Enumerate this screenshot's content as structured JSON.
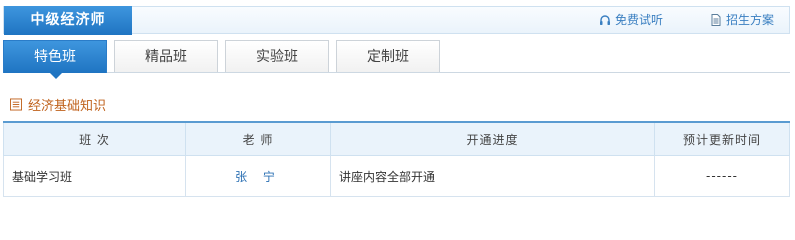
{
  "header": {
    "title": "中级经济师",
    "links": {
      "free_trial": "免费试听",
      "enrollment_plan": "招生方案"
    }
  },
  "tabs": [
    {
      "label": "特色班",
      "active": true
    },
    {
      "label": "精品班",
      "active": false
    },
    {
      "label": "实验班",
      "active": false
    },
    {
      "label": "定制班",
      "active": false
    }
  ],
  "section": {
    "title": "经济基础知识"
  },
  "table": {
    "headers": [
      "班 次",
      "老 师",
      "开通进度",
      "预计更新时间"
    ],
    "rows": [
      {
        "class_name": "基础学习班",
        "teacher": "张 宁",
        "progress": "讲座内容全部开通",
        "update_time": "------"
      }
    ]
  },
  "colors": {
    "accent_blue": "#1f74c2",
    "section_orange": "#c0621c",
    "link_blue": "#3a7fc1"
  }
}
